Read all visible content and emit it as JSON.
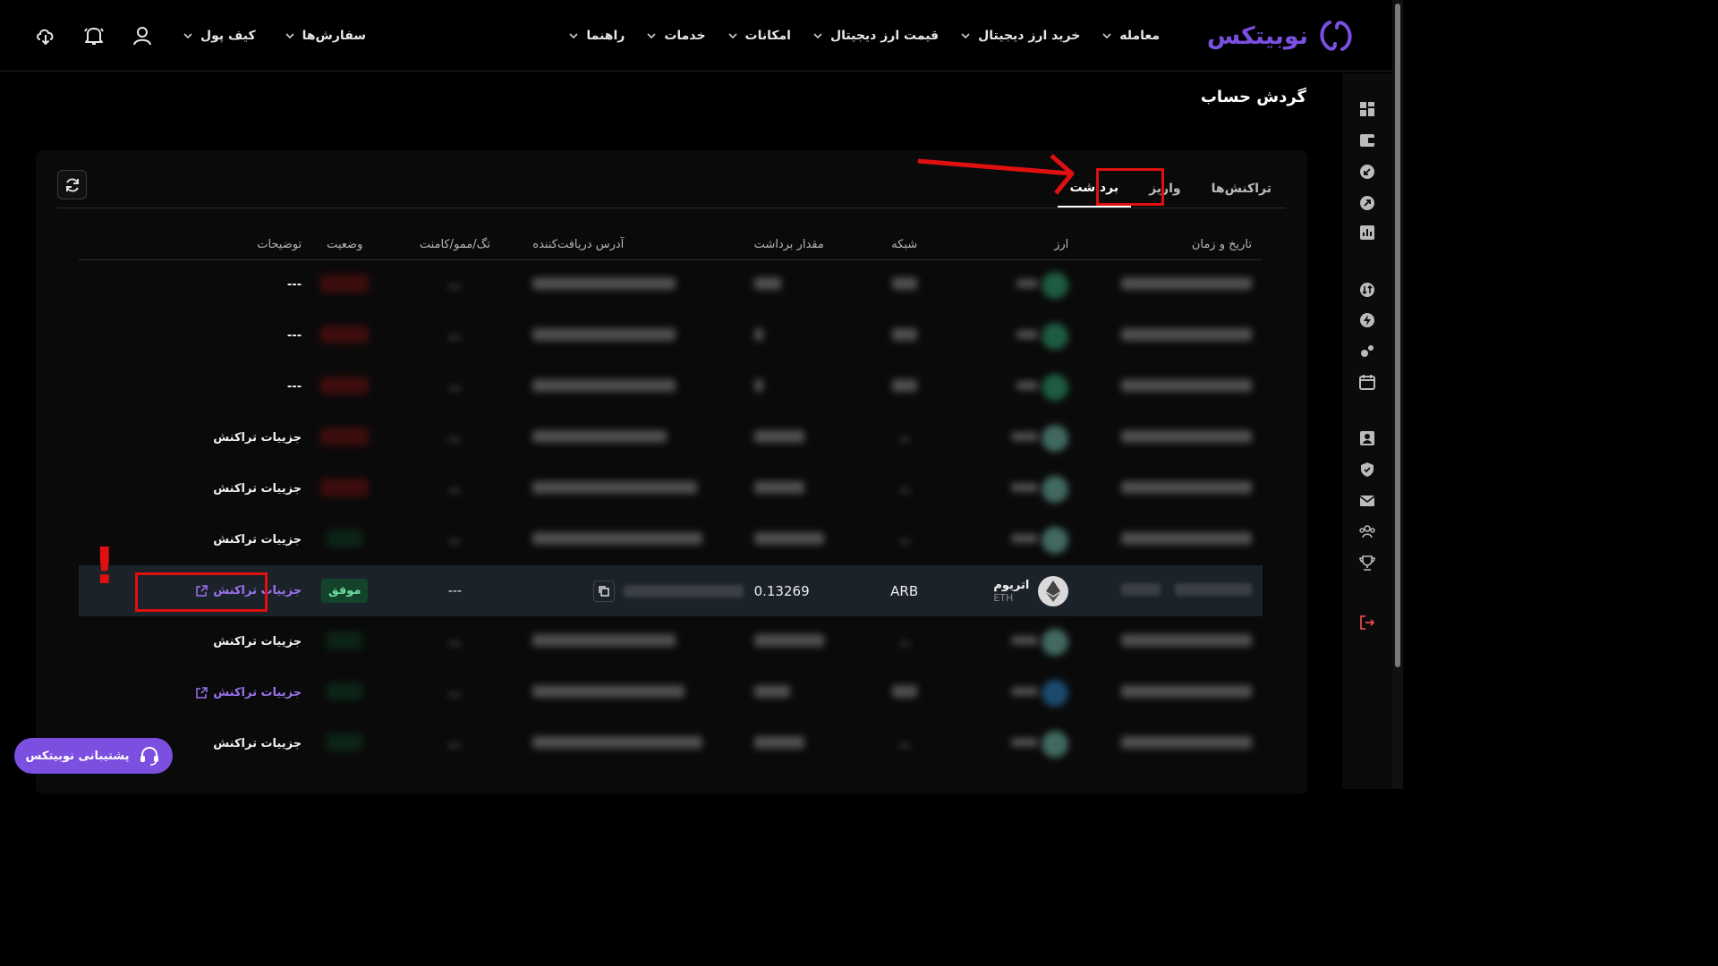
{
  "brand": {
    "name": "نوبیتکس",
    "color": "#7b4fe0"
  },
  "nav": {
    "items": [
      {
        "label": "معامله"
      },
      {
        "label": "خرید ارز دیجیتال"
      },
      {
        "label": "قیمت ارز دیجیتال"
      },
      {
        "label": "امکانات"
      },
      {
        "label": "خدمات"
      },
      {
        "label": "راهنما"
      }
    ],
    "wallet": "کیف پول",
    "orders": "سفارش‌ها"
  },
  "page": {
    "title": "گردش حساب"
  },
  "tabs": [
    {
      "label": "تراکنش‌ها",
      "active": false
    },
    {
      "label": "واریز",
      "active": false
    },
    {
      "label": "برداشت",
      "active": true
    }
  ],
  "table": {
    "columns": [
      "تاریخ و زمان",
      "ارز",
      "شبکه",
      "مقدار برداشت",
      "آدرس دریافت‌کننده",
      "تگ/ممو/کامنت",
      "وضعیت",
      "توضیحات"
    ],
    "rows": [
      {
        "blurred": true,
        "status": "failed",
        "description": "---",
        "link": false,
        "coin_color": "#2f9e6e"
      },
      {
        "blurred": true,
        "status": "failed",
        "description": "---",
        "link": false,
        "coin_color": "#2f9e6e"
      },
      {
        "blurred": true,
        "status": "failed",
        "description": "---",
        "link": false,
        "coin_color": "#2f9e6e"
      },
      {
        "blurred": true,
        "status": "failed",
        "description": "جزییات تراکنش",
        "link": false,
        "coin_color": "#6fb8a8"
      },
      {
        "blurred": true,
        "status": "failed",
        "description": "جزییات تراکنش",
        "link": false,
        "coin_color": "#6fb8a8"
      },
      {
        "blurred": true,
        "status": "success",
        "description": "جزییات تراکنش",
        "link": false,
        "coin_color": "#6fb8a8"
      },
      {
        "blurred": false,
        "highlight": true,
        "asset_name": "اتریوم",
        "asset_symbol": "ETH",
        "network": "ARB",
        "amount": "0.13269",
        "memo": "---",
        "status_label": "موفق",
        "description": "جزییات تراکنش",
        "link": true
      },
      {
        "blurred": true,
        "status": "success",
        "description": "جزییات تراکنش",
        "link": false,
        "coin_color": "#6fb8a8"
      },
      {
        "blurred": true,
        "status": "success",
        "description": "جزییات تراکنش",
        "link": true,
        "coin_color": "#2a7fc0"
      },
      {
        "blurred": true,
        "status": "success",
        "description": "جزییات تراکنش",
        "link": false,
        "coin_color": "#6fb8a8"
      }
    ]
  },
  "annotation": {
    "mark": "!"
  },
  "support": {
    "label": "پشتیبانی نوبیتکس"
  },
  "colors": {
    "annotation_red": "#e01010",
    "link_purple": "#9b73ef",
    "success_green": "#14432c"
  }
}
